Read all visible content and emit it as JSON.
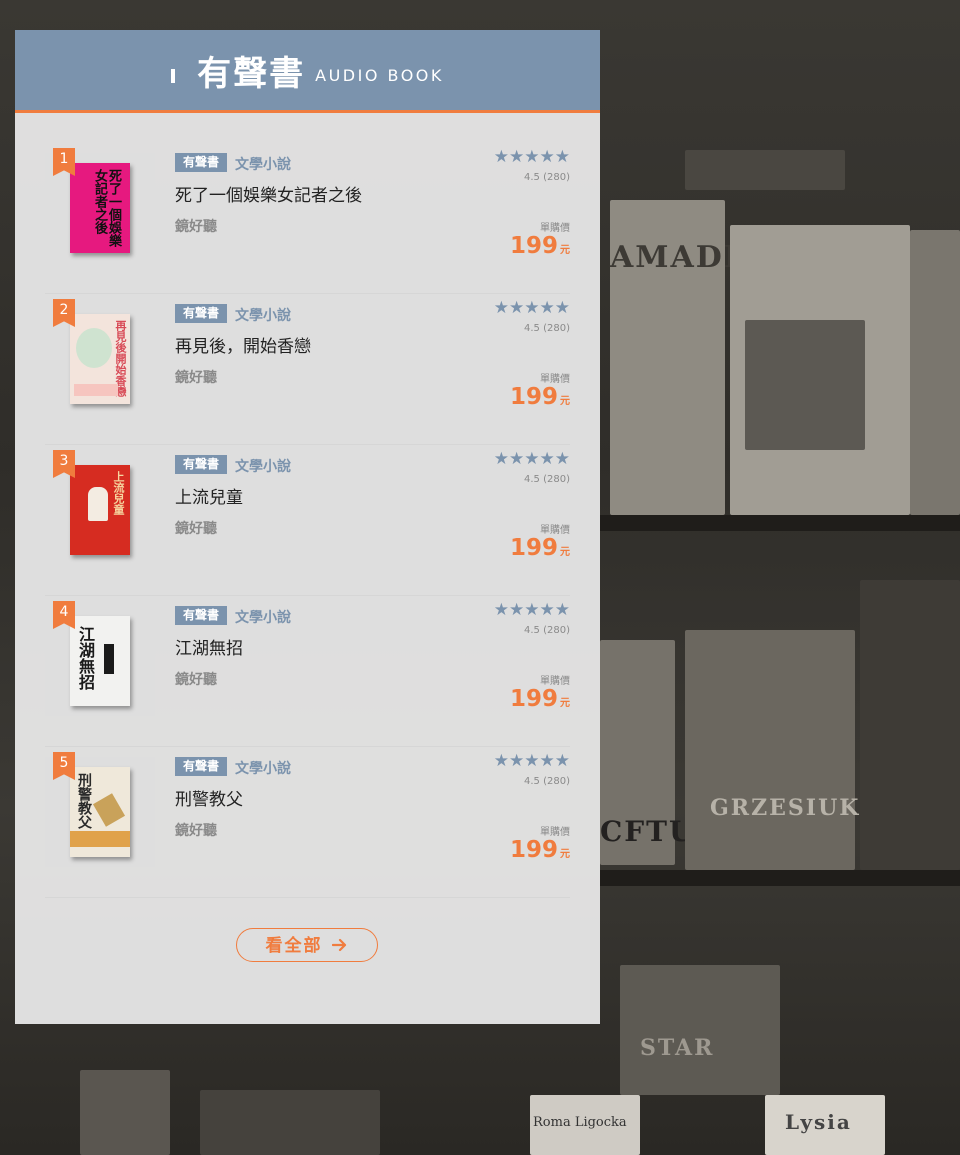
{
  "header": {
    "title": "有聲書",
    "subtitle": "AUDIO BOOK"
  },
  "background_text": [
    "AMADEUSZ",
    "GRZESIUK",
    "CFTU",
    "Roma Ligocka",
    "Lysia",
    "STAR"
  ],
  "books": [
    {
      "rank": "1",
      "tag": "有聲書",
      "category": "文學小說",
      "title": "死了一個娛樂女記者之後",
      "publisher": "鏡好聽",
      "stars": "★★★★★",
      "rating": "4.5 (280)",
      "price_label": "單購價",
      "price": "199",
      "price_unit": "元",
      "cover": {
        "bg": "#e6197f",
        "fg": "#111111",
        "text": "死了一個娛樂女記者之後"
      }
    },
    {
      "rank": "2",
      "tag": "有聲書",
      "category": "文學小說",
      "title": "再見後，開始香戀",
      "publisher": "鏡好聽",
      "stars": "★★★★★",
      "rating": "4.5 (280)",
      "price_label": "單購價",
      "price": "199",
      "price_unit": "元",
      "cover": {
        "bg": "#f3e4dc",
        "fg": "#d84b57",
        "text": "再見後開始香戀"
      }
    },
    {
      "rank": "3",
      "tag": "有聲書",
      "category": "文學小說",
      "title": "上流兒童",
      "publisher": "鏡好聽",
      "stars": "★★★★★",
      "rating": "4.5 (280)",
      "price_label": "單購價",
      "price": "199",
      "price_unit": "元",
      "cover": {
        "bg": "#d62c21",
        "fg": "#f6d6a0",
        "text": "上流兒童"
      }
    },
    {
      "rank": "4",
      "tag": "有聲書",
      "category": "文學小說",
      "title": "江湖無招",
      "publisher": "鏡好聽",
      "stars": "★★★★★",
      "rating": "4.5 (280)",
      "price_label": "單購價",
      "price": "199",
      "price_unit": "元",
      "cover": {
        "bg": "#f2f2f0",
        "fg": "#1a1a1a",
        "text": "江湖無招"
      }
    },
    {
      "rank": "5",
      "tag": "有聲書",
      "category": "文學小說",
      "title": "刑警教父",
      "publisher": "鏡好聽",
      "stars": "★★★★★",
      "rating": "4.5 (280)",
      "price_label": "單購價",
      "price": "199",
      "price_unit": "元",
      "cover": {
        "bg": "#efe8da",
        "fg": "#2a2a2a",
        "text": "刑警教父"
      }
    }
  ],
  "view_all": {
    "label": "看全部",
    "icon": "arrow-right-icon"
  },
  "colors": {
    "accent": "#f07c3e",
    "header": "#7b93ad",
    "panel": "#ececec"
  }
}
